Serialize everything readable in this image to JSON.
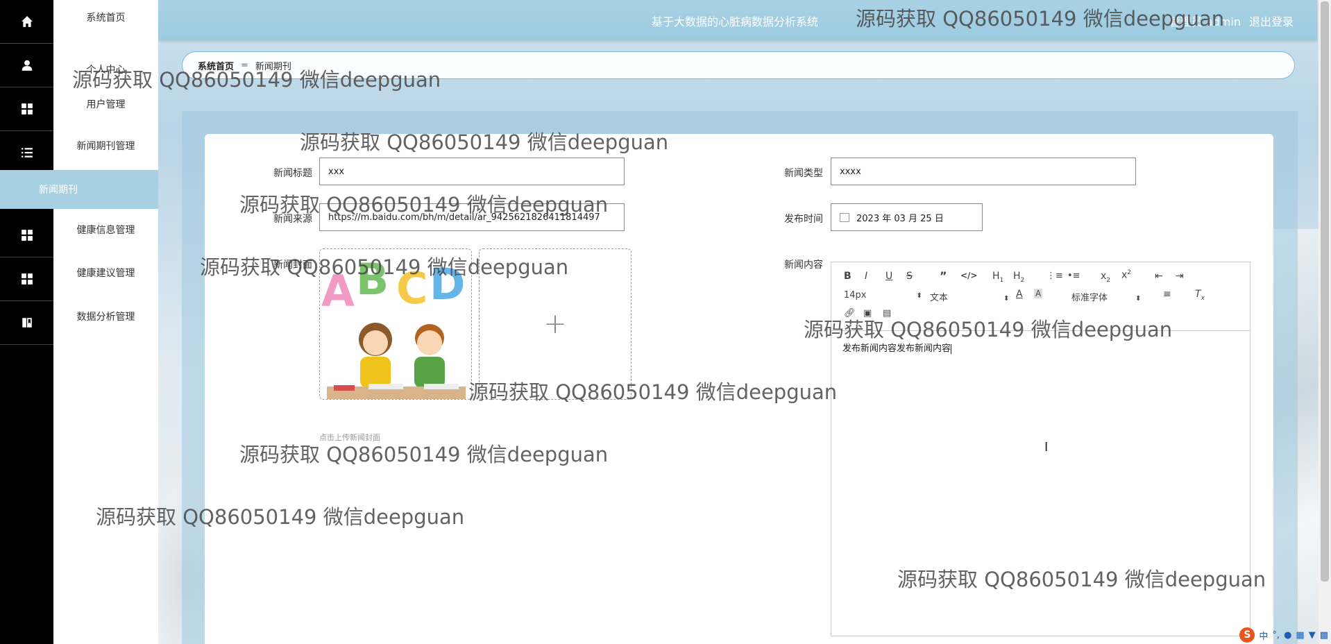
{
  "header": {
    "system_title": "基于大数据的心脏病数据分析系统",
    "user_label": "管理员 admin",
    "logout_label": "退出登录"
  },
  "sidebar": {
    "items": [
      {
        "label": "系统首页",
        "icon": "home-icon"
      },
      {
        "label": "个人中心",
        "icon": "user-icon"
      },
      {
        "label": "用户管理",
        "icon": "grid-icon"
      },
      {
        "label": "新闻期刊管理",
        "icon": "list-icon"
      },
      {
        "label": "新闻期刊",
        "icon": "",
        "active": true
      },
      {
        "label": "健康信息管理",
        "icon": "grid-icon"
      },
      {
        "label": "健康建议管理",
        "icon": "grid-icon"
      },
      {
        "label": "数据分析管理",
        "icon": "book-icon"
      }
    ]
  },
  "breadcrumb": {
    "home": "系统首页",
    "separator": "=",
    "current": "新闻期刊"
  },
  "form": {
    "title_label": "新闻标题",
    "title_value": "xxx",
    "type_label": "新闻类型",
    "type_value": "xxxx",
    "source_label": "新闻来源",
    "source_value": "https://m.baidu.com/bh/m/detail/ar_9425621826411814497",
    "date_label": "发布时间",
    "date_value": "2023 年 03 月 25 日",
    "cover_label": "新闻封面",
    "cover_hint": "点击上传新闻封面",
    "cover_letters": [
      "A",
      "B",
      "C",
      "D"
    ],
    "content_label": "新闻内容"
  },
  "editor": {
    "font_size": "14px",
    "text_type": "文本",
    "font_family": "标准字体",
    "content": "发布新闻内容发布新闻内容"
  },
  "watermark": "源码获取 QQ86050149 微信deepguan",
  "ime": {
    "logo": "S",
    "mode": "中"
  },
  "colors": {
    "header": "#a9d1e4",
    "active_menu": "#a8d0e3",
    "rail": "#000000"
  }
}
